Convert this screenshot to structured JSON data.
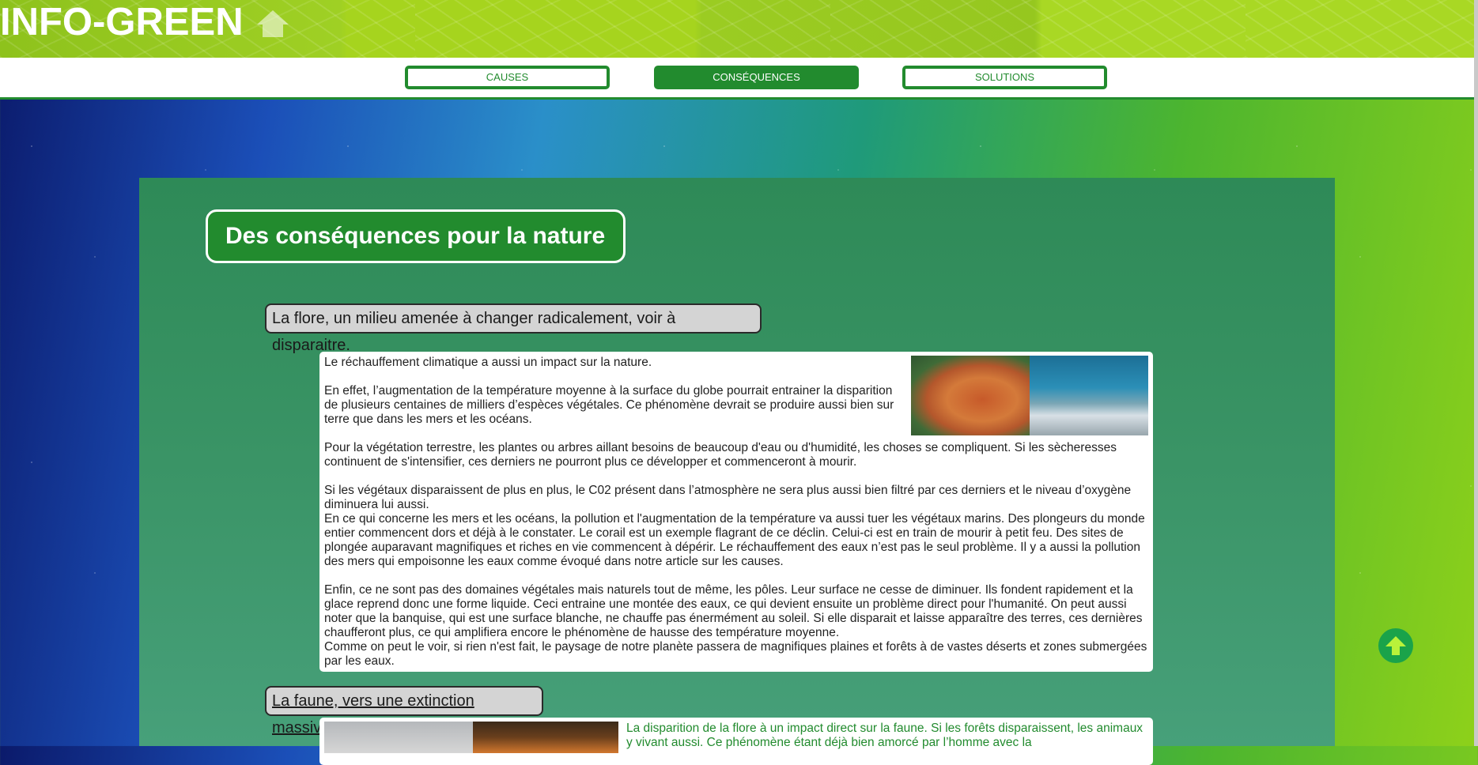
{
  "header": {
    "logo_text": "INFO-GREEN",
    "home_icon": "home-icon"
  },
  "nav": {
    "items": [
      {
        "label": "CAUSES",
        "active": false
      },
      {
        "label": "CONSÉQUENCES",
        "active": true
      },
      {
        "label": "SOLUTIONS",
        "active": false
      }
    ]
  },
  "main": {
    "title": "Des conséquences pour la nature",
    "sections": [
      {
        "title": "La flore, un milieu amenée à changer radicalement, voir à disparaitre.",
        "paragraphs": [
          "Le réchauffement climatique a aussi un impact sur la nature.",
          "En effet, l’augmentation de la température moyenne à la surface du globe pourrait entrainer la disparition de plusieurs centaines de milliers d’espèces végétales. Ce phénomène devrait se produire aussi bien sur terre que dans les mers et les océans.",
          "Pour la végétation terrestre, les plantes ou arbres aillant besoins de beaucoup d'eau ou d'humidité, les choses se compliquent. Si les sècheresses continuent de s'intensifier, ces derniers ne pourront plus ce développer et commenceront à mourir.",
          "Si les végétaux disparaissent de plus en plus, le C02 présent dans l’atmosphère ne sera plus aussi bien filtré par ces derniers et le niveau d’oxygène diminuera lui aussi.",
          "En ce qui concerne les mers et les océans, la pollution et l'augmentation de la température va aussi tuer les végétaux marins. Des plongeurs du monde entier commencent dors et déjà à le constater. Le corail est un exemple flagrant de ce déclin. Celui-ci est en train de mourir à petit feu. Des sites de plongée auparavant magnifiques et riches en vie commencent à dépérir. Le réchauffement des eaux n’est pas le seul problème. Il y a aussi la pollution des mers qui empoisonne les eaux comme évoqué dans notre article sur les causes.",
          "Enfin, ce ne sont pas des domaines végétales mais naturels tout de même, les pôles. Leur surface ne cesse de diminuer. Ils fondent rapidement et la glace reprend donc une forme liquide. Ceci entraine une montée des eaux, ce qui devient ensuite un problème direct pour l'humanité. On peut aussi noter que la banquise, qui est une surface blanche, ne chauffe pas énermément au soleil. Si elle disparait et laisse apparaître des terres, ces dernières chaufferont plus, ce qui amplifiera encore le phénomène de hausse des température moyenne.",
          "Comme on peut le voir, si rien n'est fait, le paysage de notre planète passera de magnifiques plaines et forêts à de vastes déserts et zones submergées par les eaux."
        ]
      },
      {
        "title": "La faune, vers une extinction massive",
        "paragraphs": [
          "La disparition de la flore à un impact direct sur la faune. Si les forêts disparaissent, les animaux y vivant aussi. Ce phénomène étant déjà bien amorcé par l’homme avec la"
        ]
      }
    ]
  },
  "colors": {
    "primary_green": "#228b2e",
    "panel_green": "#2e8a57",
    "header_lime": "#a6d41e"
  }
}
